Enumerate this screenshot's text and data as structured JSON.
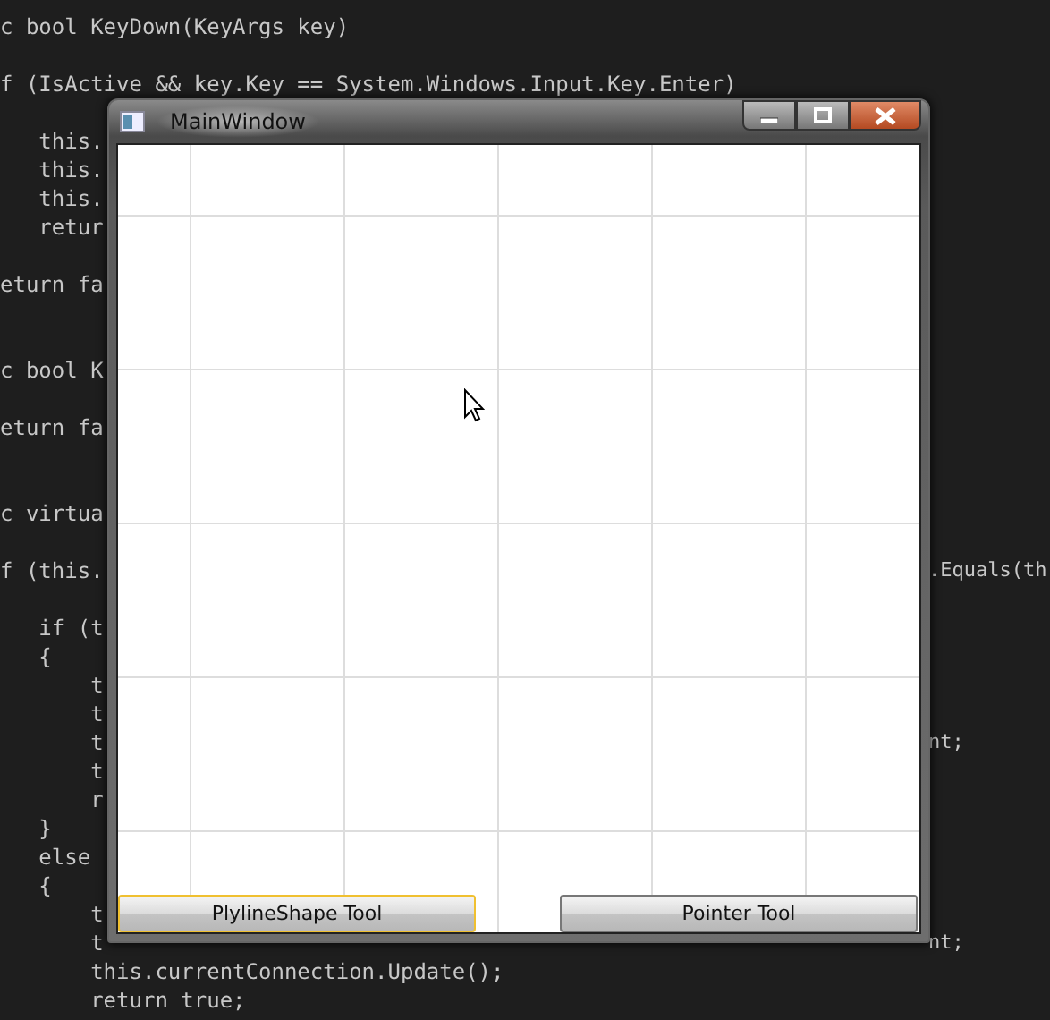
{
  "editor": {
    "lines": [
      {
        "kind": "code",
        "left": "c bool KeyDown(KeyArgs key)"
      },
      {
        "kind": "blank"
      },
      {
        "kind": "code",
        "left": "f (IsActive && key.Key == System.Windows.Input.Key.Enter)"
      },
      {
        "kind": "blank"
      },
      {
        "kind": "code",
        "left": "   this."
      },
      {
        "kind": "code",
        "left": "   this."
      },
      {
        "kind": "code",
        "left": "   this."
      },
      {
        "kind": "code",
        "left": "   retur"
      },
      {
        "kind": "blank"
      },
      {
        "kind": "code",
        "left": "eturn fa"
      },
      {
        "kind": "blank"
      },
      {
        "kind": "blank"
      },
      {
        "kind": "code",
        "left": "c bool K"
      },
      {
        "kind": "blank"
      },
      {
        "kind": "code",
        "left": "eturn fa"
      },
      {
        "kind": "blank"
      },
      {
        "kind": "blank"
      },
      {
        "kind": "code",
        "left": "c virtua"
      },
      {
        "kind": "blank"
      },
      {
        "kind": "code",
        "left": "f (this.",
        "right": ".Equals(th"
      },
      {
        "kind": "blank"
      },
      {
        "kind": "code",
        "left": "   if (t"
      },
      {
        "kind": "code",
        "left": "   {"
      },
      {
        "kind": "code",
        "left": "       t"
      },
      {
        "kind": "code",
        "left": "       t"
      },
      {
        "kind": "code",
        "left": "       t",
        "right": "nt;"
      },
      {
        "kind": "code",
        "left": "       t"
      },
      {
        "kind": "code",
        "left": "       r"
      },
      {
        "kind": "code",
        "left": "   }"
      },
      {
        "kind": "code",
        "left": "   else"
      },
      {
        "kind": "code",
        "left": "   {"
      },
      {
        "kind": "code",
        "left": "       t"
      },
      {
        "kind": "code",
        "left": "       t",
        "right": "nt;"
      },
      {
        "kind": "code",
        "left": "       this.currentConnection.Update();"
      },
      {
        "kind": "code",
        "left": "       return true;"
      }
    ]
  },
  "window": {
    "title": "MainWindow",
    "buttons": [
      {
        "label": "PlylineShape Tool",
        "focused": true
      },
      {
        "label": "Pointer Tool",
        "focused": false
      }
    ]
  }
}
